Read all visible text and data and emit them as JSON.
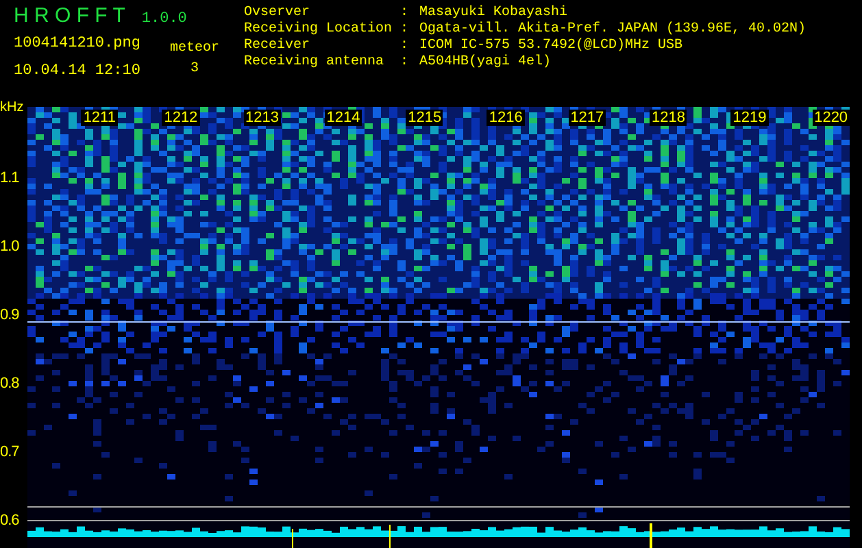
{
  "header": {
    "app_name": "H R O F F T",
    "version": "1.0.0",
    "file_name": "1004141210.png",
    "timestamp": "10.04.14 12:10",
    "meteor_label": "meteor",
    "meteor_count": "3"
  },
  "info": [
    {
      "label": "Ovserver",
      "separator": ":",
      "value": "Masayuki Kobayashi"
    },
    {
      "label": "Receiving Location",
      "separator": ":",
      "value": "Ogata-vill. Akita-Pref. JAPAN (139.96E, 40.02N)"
    },
    {
      "label": "Receiver",
      "separator": ":",
      "value": "ICOM IC-575 53.7492(@LCD)MHz USB"
    },
    {
      "label": "Receiving antenna",
      "separator": ":",
      "value": "A504HB(yagi 4el)"
    }
  ],
  "y_axis": {
    "unit": "kHz",
    "labels": [
      "1.1",
      "1.0",
      "0.9",
      "0.8",
      "0.7",
      "0.6"
    ]
  },
  "time_labels": [
    "1211",
    "1212",
    "1213",
    "1214",
    "1215",
    "1216",
    "1217",
    "1218",
    "1219",
    "1220"
  ]
}
